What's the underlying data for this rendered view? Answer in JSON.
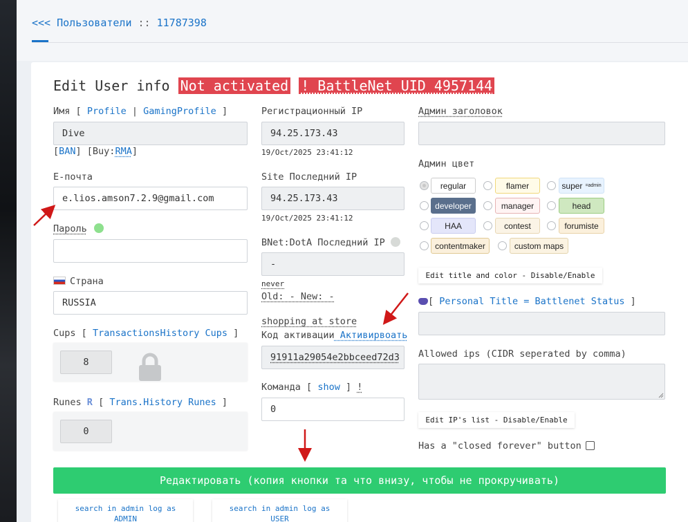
{
  "header": {
    "back": "<<<",
    "section": "Пользователи",
    "sep": "::",
    "user_id": "11787398"
  },
  "title": {
    "text": "Edit User info",
    "status_badge": "Not activated",
    "bnet_badge": "! BattleNet UID 4957144"
  },
  "left": {
    "name_label": "Имя",
    "bracket_open": "[",
    "profile_link": "Profile",
    "pipe": "|",
    "gaming_profile_link": "GamingProfile",
    "bracket_close": "]",
    "name_value": "Dive",
    "ban_open": "[",
    "ban_link": "BAN",
    "ban_mid": "] [Buy:",
    "rma_link": "RMA",
    "rma_close": "]",
    "email_label": "E-почта",
    "email_value": "e.lios.amson7.2.9@gmail.com",
    "password_label": "Пароль",
    "password_value": "",
    "country_label": "Страна",
    "country_value": "RUSSIA",
    "cups_label": "Cups",
    "cups_link": "TransactionsHistory Cups",
    "cups_value": "8",
    "runes_label": "Runes",
    "runes_icon": "R",
    "runes_link": "Trans.History Runes",
    "runes_value": "0"
  },
  "middle": {
    "reg_ip_label": "Регистрационный IP",
    "reg_ip_value": "94.25.173.43",
    "reg_ip_date": "19/Oct/2025 23:41:12",
    "last_ip_label": "Site Последний IP",
    "last_ip_value": "94.25.173.43",
    "last_ip_date": "19/Oct/2025 23:41:12",
    "bnet_ip_label": "BNet:DotA Последний IP",
    "bnet_ip_value": "-",
    "never": "never",
    "old_new": "Old: - New: -",
    "shopping": "shopping at store",
    "activation_label": "Код активации",
    "activate_link": " Активирвоать",
    "activation_value": "91911a29054e2bbceed72d3",
    "team_label": "Команда",
    "team_open": "[",
    "show_link": "show",
    "team_close": "]",
    "team_bang": "!",
    "team_value": "0"
  },
  "right": {
    "admin_title_label": "Админ заголовок",
    "admin_title_value": "",
    "admin_color_label": "Админ цвет",
    "colors": [
      {
        "label": "regular",
        "bg": "#ffffff",
        "border": "#cccccc",
        "color": "#222222"
      },
      {
        "label": "flamer",
        "bg": "#fffbe8",
        "border": "#f0d77a",
        "color": "#222222"
      },
      {
        "label": "super",
        "sub": "=admin",
        "bg": "#e8f3ff",
        "border": "#cfe2f5",
        "color": "#222222"
      },
      {
        "label": "developer",
        "bg": "#5a6f8c",
        "border": "#5a6f8c",
        "color": "#ffffff"
      },
      {
        "label": "manager",
        "bg": "#fff4f4",
        "border": "#e6b3b3",
        "color": "#222222"
      },
      {
        "label": "head",
        "bg": "#cfe8c0",
        "border": "#9ccc82",
        "color": "#222222"
      },
      {
        "label": "HAA",
        "bg": "#e4e6fa",
        "border": "#c9ccef",
        "color": "#222222"
      },
      {
        "label": "contest",
        "bg": "#fbf4e6",
        "border": "#e8d7b3",
        "color": "#222222"
      },
      {
        "label": "forumiste",
        "bg": "#fbf0dc",
        "border": "#e8d2a8",
        "color": "#222222"
      },
      {
        "label": "contentmaker",
        "bg": "#fbf0dc",
        "border": "#e0c994",
        "color": "#222222"
      },
      {
        "label": "custom maps",
        "bg": "#fbf3e2",
        "border": "#e3d3ad",
        "color": "#222222"
      }
    ],
    "edit_title_btn": "Edit title and color - Disable/Enable",
    "personal_title_open": "[",
    "personal_title_link": "Personal Title = Battlenet Status",
    "personal_title_close": "]",
    "personal_title_value": "",
    "allowed_ips_label": "Allowed ips (CIDR seperated by comma)",
    "allowed_ips_value": "",
    "edit_ips_btn": "Edit IP's list - Disable/Enable",
    "closed_forever_label": "Has a \"closed forever\" button"
  },
  "actions": {
    "submit": "Редактировать (копия кнопки та что внизу, чтобы не прокручивать)",
    "log_admin_line1": "search in admin log as",
    "log_admin_line2": "ADMIN",
    "log_user_line1": "search in admin log as",
    "log_user_line2": "USER"
  },
  "colors": {
    "link": "#1a73c8",
    "danger": "#e0454f",
    "success": "#2ecc71",
    "annotation_arrow": "#d01818"
  }
}
